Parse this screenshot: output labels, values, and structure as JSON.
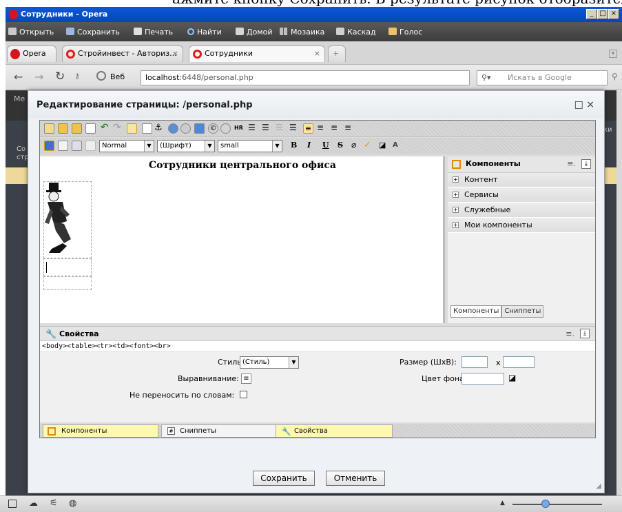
{
  "doc_top_text": "ажмите кнопку Сохранить. В результате рисунок отобразится на",
  "window": {
    "title": "Сотрудники - Opera"
  },
  "menu": {
    "items": [
      {
        "label": "Открыть",
        "icon": "folder-icon"
      },
      {
        "label": "Сохранить",
        "icon": "save-icon"
      },
      {
        "label": "Печать",
        "icon": "print-icon"
      },
      {
        "label": "Найти",
        "icon": "search-icon"
      },
      {
        "label": "Домой",
        "icon": "home-icon"
      },
      {
        "label": "Мозаика",
        "icon": "tile-icon"
      },
      {
        "label": "Каскад",
        "icon": "cascade-icon"
      },
      {
        "label": "Голос",
        "icon": "voice-icon"
      }
    ]
  },
  "tabs": {
    "opera_label": "Opera",
    "items": [
      {
        "label": "Стройинвест - Авториз...",
        "close": "×"
      },
      {
        "label": "Сотрудники",
        "close": "×"
      }
    ]
  },
  "address": {
    "web_label": "Веб",
    "url_host": "localhost",
    "url_rest": ":6448/personal.php",
    "search_placeholder": "Искать в Google"
  },
  "background_fragments": {
    "left_a": "Ме",
    "left_b": "Со",
    "left_c": "стр",
    "right_a": "ки"
  },
  "dialog": {
    "title": "Редактирование страницы: /personal.php",
    "controls": "□ ×",
    "toolbar": {
      "format_select": "Normal",
      "font_select": "(Шрифт)",
      "size_select": "small",
      "bold": "B",
      "italic": "I",
      "underline": "U",
      "strike": "S"
    },
    "content": {
      "title": "Сотрудники центрального офиса"
    },
    "components_panel": {
      "title": "Компоненты",
      "items": [
        "Контент",
        "Сервисы",
        "Служебные",
        "Мои компоненты"
      ],
      "tab_components": "Компоненты",
      "tab_snippets": "Сниппеты"
    },
    "properties": {
      "title": "Свойства",
      "tag_path": "<body><table><tr><td><font><br>",
      "style_label": "Стиль:",
      "style_value": "(Стиль)",
      "align_label": "Выравнивание:",
      "nowrap_label": "Не переносить по словам:",
      "size_label": "Размер (ШxВ):",
      "size_x": "x",
      "bgcolor_label": "Цвет фона:"
    },
    "bottom_tabs": [
      "Компоненты",
      "Сниппеты",
      "Свойства"
    ],
    "buttons": {
      "save": "Сохранить",
      "cancel": "Отменить"
    }
  },
  "colors": {
    "titlebar": "#0a58d8",
    "accent_yellow": "#fff9b0",
    "opera_red": "#d8141a"
  }
}
